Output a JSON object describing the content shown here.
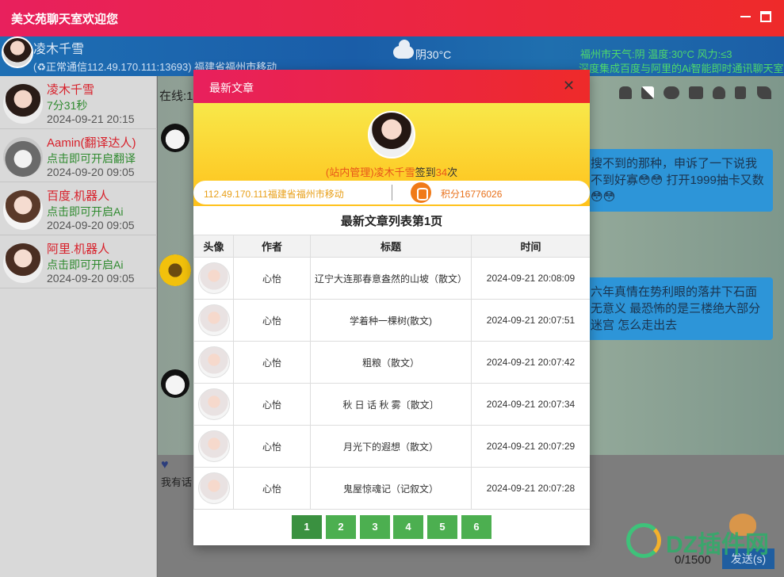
{
  "titlebar": {
    "title": "美文苑聊天室欢迎您"
  },
  "header": {
    "username": "凌木千雪",
    "connection": "(♻正常通信112.49.170.111:13693) 福建省福州市移动",
    "weather": "阴30°C",
    "ticker1": "福州市天气:阴 温度:30°C 风力:≤3",
    "ticker2": "深度集成百度与阿里的Ai智能即时通讯聊天室"
  },
  "users": [
    {
      "name": "凌木千雪",
      "sub": "7分31秒",
      "time": "2024-09-21 20:15"
    },
    {
      "name": "Aamin(翻译达人)",
      "sub": "点击即可开启翻译",
      "time": "2024-09-20 09:05"
    },
    {
      "name": "百度.机器人",
      "sub": "点击即可开启Ai",
      "time": "2024-09-20 09:05"
    },
    {
      "name": "阿里.机器人",
      "sub": "点击即可开启Ai",
      "time": "2024-09-20 09:05"
    }
  ],
  "chat": {
    "online": "在线:1",
    "bubble1": "搜不到的那种，申诉了一下说我不到好寡😳😳 打开1999抽卡又数😳😳",
    "bubble2": "六年真情在势利眼的落井下石面无意义 最恐怖的是三楼绝大部分迷宫 怎么走出去",
    "input_hint": "我有话",
    "counter": "0/1500",
    "send_label": "发送(s)"
  },
  "modal": {
    "title": "最新文章",
    "close": "✕",
    "signin": {
      "role": "(站内管理)",
      "nick": "凌木千雪",
      "text_before_days": "签到",
      "days": "34",
      "unit": "次"
    },
    "ip_location": "112.49.170.111福建省福州市移动",
    "score": "积分16776026",
    "list_title": "最新文章列表第1页",
    "columns": [
      "头像",
      "作者",
      "标题",
      "时间"
    ],
    "articles": [
      {
        "author": "心怡",
        "title": "辽宁大连那春意盎然的山坡（散文）",
        "time": "2024-09-21 20:08:09"
      },
      {
        "author": "心怡",
        "title": "学着种一棵树(散文)",
        "time": "2024-09-21 20:07:51"
      },
      {
        "author": "心怡",
        "title": "粗粮（散文）",
        "time": "2024-09-21 20:07:42"
      },
      {
        "author": "心怡",
        "title": "秋 日 话 秋 雾〔散文〕",
        "time": "2024-09-21 20:07:34"
      },
      {
        "author": "心怡",
        "title": "月光下的遐想（散文）",
        "time": "2024-09-21 20:07:29"
      },
      {
        "author": "心怡",
        "title": "鬼屋惊魂记（记叙文）",
        "time": "2024-09-21 20:07:28"
      }
    ],
    "pages": [
      "1",
      "2",
      "3",
      "4",
      "5",
      "6"
    ],
    "current_page": "1"
  },
  "watermark": {
    "text": "DZ插件网"
  }
}
